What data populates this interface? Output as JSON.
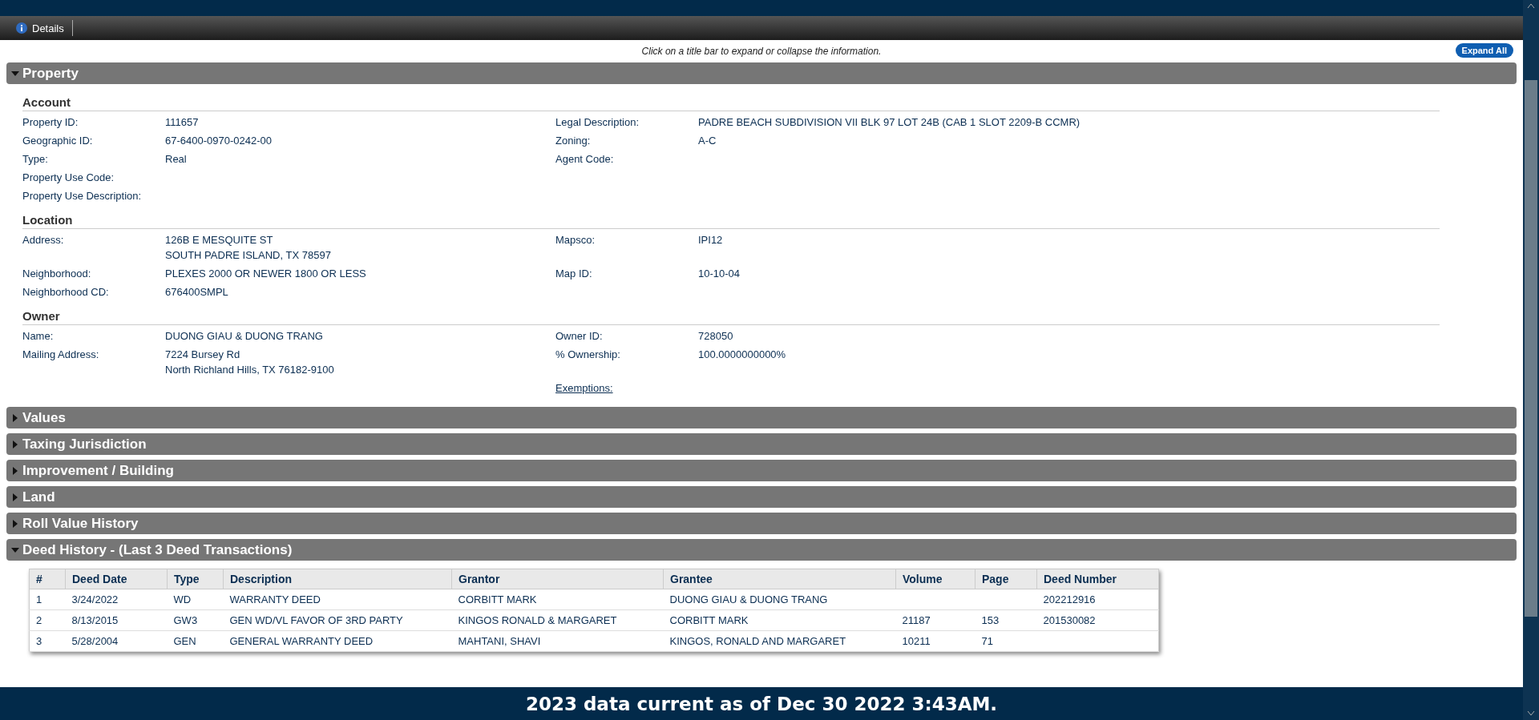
{
  "toolbar": {
    "label": "Details"
  },
  "hint": "Click on a title bar to expand or collapse the information.",
  "expand_all": "Expand All",
  "sections": [
    {
      "title": "Property",
      "expanded": true,
      "groups": [
        {
          "title": "Account",
          "rows": [
            {
              "left": {
                "label": "Property ID:",
                "lines": [
                  "111657"
                ]
              },
              "right": {
                "label": "Legal Description:",
                "lines": [
                  "PADRE BEACH SUBDIVISION VII BLK 97 LOT 24B (CAB 1 SLOT 2209-B CCMR)"
                ]
              }
            },
            {
              "left": {
                "label": "Geographic ID:",
                "lines": [
                  "67-6400-0970-0242-00"
                ]
              },
              "right": {
                "label": "Zoning:",
                "lines": [
                  "A-C"
                ]
              }
            },
            {
              "left": {
                "label": "Type:",
                "lines": [
                  "Real"
                ]
              },
              "right": {
                "label": "Agent Code:"
              }
            },
            {
              "left": {
                "label": "Property Use Code:"
              }
            },
            {
              "left": {
                "label": "Property Use Description:"
              }
            }
          ]
        },
        {
          "title": "Location",
          "rows": [
            {
              "left": {
                "label": "Address:",
                "lines": [
                  "126B E MESQUITE ST",
                  "SOUTH PADRE ISLAND, TX 78597"
                ]
              },
              "right": {
                "label": "Mapsco:",
                "lines": [
                  "IPI12"
                ]
              }
            },
            {
              "left": {
                "label": "Neighborhood:",
                "lines": [
                  "PLEXES 2000 OR NEWER 1800 OR LESS"
                ]
              },
              "right": {
                "label": "Map ID:",
                "lines": [
                  "10-10-04"
                ]
              }
            },
            {
              "left": {
                "label": "Neighborhood CD:",
                "lines": [
                  "676400SMPL"
                ]
              }
            }
          ]
        },
        {
          "title": "Owner",
          "rows": [
            {
              "left": {
                "label": "Name:",
                "lines": [
                  "DUONG GIAU & DUONG TRANG"
                ]
              },
              "right": {
                "label": "Owner ID:",
                "lines": [
                  "728050"
                ]
              }
            },
            {
              "left": {
                "label": "Mailing Address:",
                "lines": [
                  "7224 Bursey Rd",
                  "North Richland Hills, TX 76182-9100"
                ]
              },
              "right": {
                "label": "% Ownership:",
                "lines": [
                  "100.0000000000%"
                ]
              }
            },
            {
              "right": {
                "label": "Exemptions:",
                "kind": "link"
              }
            }
          ]
        }
      ]
    },
    {
      "title": "Values",
      "expanded": false
    },
    {
      "title": "Taxing Jurisdiction",
      "expanded": false
    },
    {
      "title": "Improvement / Building",
      "expanded": false
    },
    {
      "title": "Land",
      "expanded": false
    },
    {
      "title": "Roll Value History",
      "expanded": false
    },
    {
      "title": "Deed History - (Last 3 Deed Transactions)",
      "expanded": true,
      "table": {
        "columns": [
          "#",
          "Deed Date",
          "Type",
          "Description",
          "Grantor",
          "Grantee",
          "Volume",
          "Page",
          "Deed Number"
        ],
        "rows": [
          [
            "1",
            "3/24/2022",
            "WD",
            "WARRANTY DEED",
            "CORBITT MARK",
            "DUONG GIAU & DUONG TRANG",
            "",
            "",
            "202212916"
          ],
          [
            "2",
            "8/13/2015",
            "GW3",
            "GEN WD/VL FAVOR OF 3RD PARTY",
            "KINGOS RONALD & MARGARET",
            "CORBITT MARK",
            "21187",
            "153",
            "201530082"
          ],
          [
            "3",
            "5/28/2004",
            "GEN",
            "GENERAL WARRANTY DEED",
            "MAHTANI, SHAVI",
            "KINGOS, RONALD AND MARGARET",
            "10211",
            "71",
            ""
          ]
        ]
      }
    }
  ],
  "footer": "2023 data current as of Dec 30 2022 3:43AM."
}
